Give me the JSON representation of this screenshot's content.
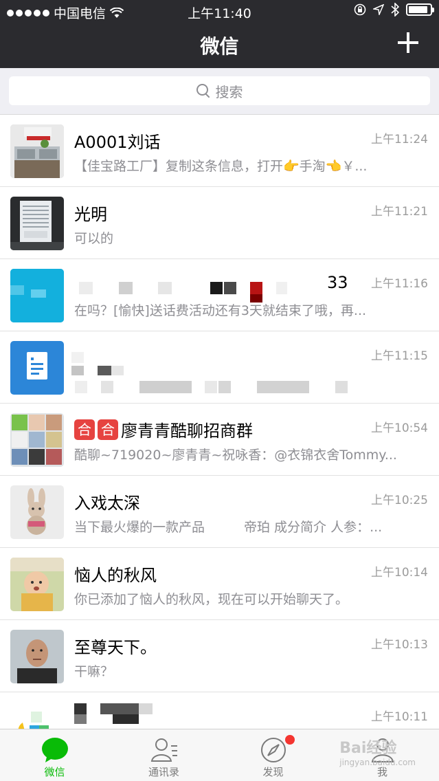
{
  "status_bar": {
    "carrier": "中国电信",
    "time": "上午11:40",
    "battery_level": 0.9
  },
  "nav": {
    "title": "微信",
    "add_icon": "plus-icon"
  },
  "search": {
    "placeholder": "搜索"
  },
  "chats": [
    {
      "name": "A0001刘话",
      "time": "上午11:24",
      "preview": "【佳宝路工厂】复制这条信息，打开👉手淘👈￥..."
    },
    {
      "name": "光明",
      "time": "上午11:21",
      "preview": "可以的"
    },
    {
      "name": "33",
      "time": "上午11:16",
      "preview": "在吗？[愉快]送话费活动还有3天就结束了哦，再..."
    },
    {
      "name": "",
      "time": "上午11:15",
      "preview": ""
    },
    {
      "name": "廖青青酷聊招商群",
      "badge": "合",
      "time": "上午10:54",
      "preview": "酷聊~719020~廖青青~祝咏香：@衣锦衣舍Tommy..."
    },
    {
      "name": "入戏太深",
      "time": "上午10:25",
      "preview": "当下最火爆的一款产品　　　帝珀 成分简介 人参：..."
    },
    {
      "name": "恼人的秋风",
      "time": "上午10:14",
      "preview": "你已添加了恼人的秋风，现在可以开始聊天了。"
    },
    {
      "name": "至尊天下。",
      "time": "上午10:13",
      "preview": "干嘛？"
    },
    {
      "name": "",
      "time": "上午10:11",
      "preview": ""
    }
  ],
  "tabs": [
    {
      "label": "微信",
      "icon": "chat-bubble-icon",
      "active": true
    },
    {
      "label": "通讯录",
      "icon": "contacts-icon",
      "active": false
    },
    {
      "label": "发现",
      "icon": "compass-icon",
      "active": false
    },
    {
      "label": "我",
      "icon": "person-icon",
      "active": false
    }
  ],
  "watermark": {
    "text": "Bai经验",
    "sub": "jingyan.baidu.com"
  },
  "colors": {
    "header_bg": "#2b2b2f",
    "accent_green": "#09bb07",
    "badge_red": "#e64340"
  }
}
